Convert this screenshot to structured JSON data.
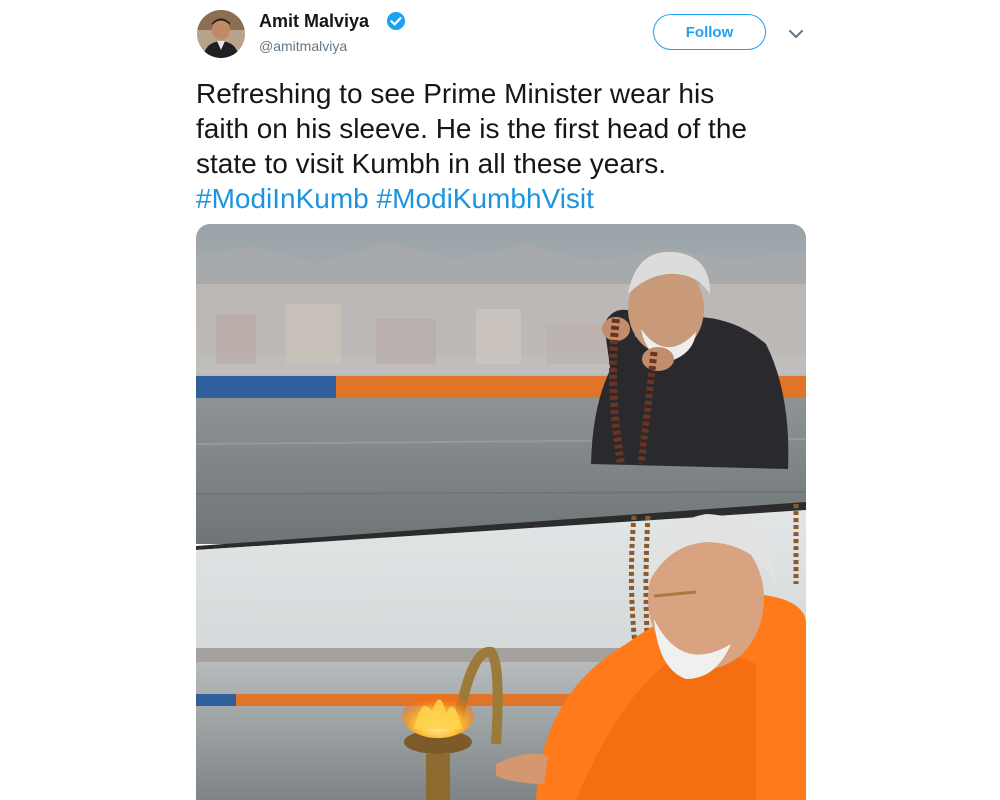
{
  "user": {
    "name": "Amit Malviya",
    "handle": "@amitmalviya",
    "verified": true,
    "avatar_icon": "profile-photo"
  },
  "actions": {
    "follow_label": "Follow",
    "menu_icon": "chevron-down-icon"
  },
  "tweet": {
    "lines": [
      "Refreshing to see Prime Minister wear his",
      "faith on his sleeve. He is the first head of the",
      "state to visit Kumbh in all these years."
    ],
    "hashtags": [
      "#ModiInKumb",
      "#ModiKumbhVisit"
    ]
  },
  "media": {
    "image_count": 2
  },
  "colors": {
    "accent": "#1da1f2",
    "hashtag": "#1b95e0",
    "text": "#14171a",
    "muted": "#657786"
  }
}
